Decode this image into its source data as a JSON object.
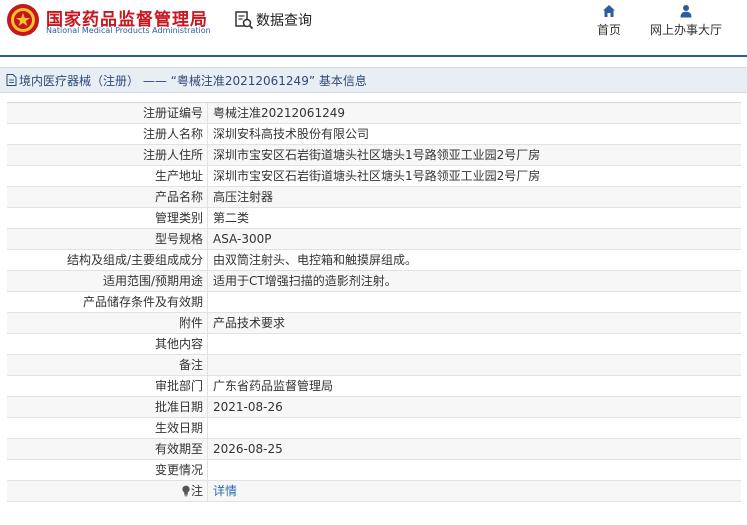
{
  "header": {
    "brand_cn": "国家药品监督管理局",
    "brand_en": "National Medical Products Administration",
    "query_label": "数据查询",
    "nav": [
      {
        "label": "首页",
        "icon": "home-icon"
      },
      {
        "label": "网上办事大厅",
        "icon": "user-icon"
      }
    ]
  },
  "titlebar": {
    "text": "境内医疗器械（注册） —— “粤械注准20212061249” 基本信息"
  },
  "rows": [
    {
      "label": "注册证编号",
      "value": "粤械注准20212061249"
    },
    {
      "label": "注册人名称",
      "value": "深圳安科高技术股份有限公司"
    },
    {
      "label": "注册人住所",
      "value": "深圳市宝安区石岩街道塘头社区塘头1号路领亚工业园2号厂房"
    },
    {
      "label": "生产地址",
      "value": "深圳市宝安区石岩街道塘头社区塘头1号路领亚工业园2号厂房"
    },
    {
      "label": "产品名称",
      "value": "高压注射器"
    },
    {
      "label": "管理类别",
      "value": "第二类"
    },
    {
      "label": "型号规格",
      "value": "ASA-300P"
    },
    {
      "label": "结构及组成/主要组成成分",
      "value": "由双筒注射头、电控箱和触摸屏组成。"
    },
    {
      "label": "适用范围/预期用途",
      "value": "适用于CT增强扫描的造影剂注射。"
    },
    {
      "label": "产品储存条件及有效期",
      "value": ""
    },
    {
      "label": "附件",
      "value": "产品技术要求"
    },
    {
      "label": "其他内容",
      "value": ""
    },
    {
      "label": "备注",
      "value": ""
    },
    {
      "label": "审批部门",
      "value": "广东省药品监督管理局"
    },
    {
      "label": "批准日期",
      "value": "2021-08-26"
    },
    {
      "label": "生效日期",
      "value": ""
    },
    {
      "label": "有效期至",
      "value": "2026-08-25"
    },
    {
      "label": "变更情况",
      "value": ""
    },
    {
      "label": "注",
      "value": "详情"
    }
  ],
  "colors": {
    "brand_red": "#c7161d",
    "brand_blue": "#2b5e9e",
    "link_blue": "#2a6db5"
  }
}
